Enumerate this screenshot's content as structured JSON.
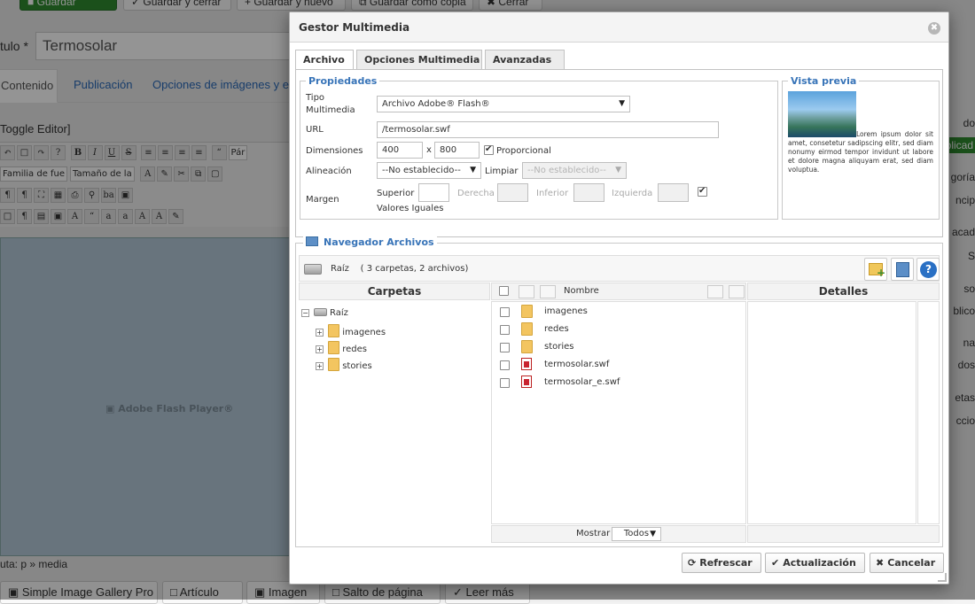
{
  "background": {
    "toolbar": [
      "Guardar",
      "Guardar y cerrar",
      "Guardar y nuevo",
      "Guardar como copia",
      "Cerrar"
    ],
    "title_label": "tulo *",
    "title_value": "Termosolar",
    "tabs": [
      "Contenido",
      "Publicación",
      "Opciones de imágenes y en"
    ],
    "toggle_editor": "Toggle Editor]",
    "editor_font_family": "Familia de fue",
    "editor_font_size": "Tamaño de la",
    "editor_paragraph": "Pár",
    "flash_label": "Adobe Flash Player®",
    "path": "uta: p » media",
    "bottom_buttons": [
      "Simple Image Gallery Pro",
      "Artículo",
      "Imagen",
      "Salto de página",
      "Leer más"
    ],
    "right_labels": [
      "do",
      "plicad",
      "goría",
      "ncip",
      "acad",
      "S",
      "so",
      "blico",
      "na",
      "dos",
      "etas",
      "ccio"
    ]
  },
  "modal": {
    "title": "Gestor Multimedia",
    "close_icon": "close-icon",
    "tabs": [
      "Archivo",
      "Opciones Multimedia",
      "Avanzadas"
    ],
    "properties": {
      "legend": "Propiedades",
      "tipo_label_1": "Tipo",
      "tipo_label_2": "Multimedia",
      "tipo_value": "Archivo Adobe® Flash®",
      "url_label": "URL",
      "url_value": "/termosolar.swf",
      "dimensions_label": "Dimensiones",
      "width": "400",
      "x": "x",
      "height": "800",
      "proportional_label": "Proporcional",
      "proportional_checked": true,
      "align_label": "Alineación",
      "align_value": "--No establecido--",
      "clear_label": "Limpiar",
      "clear_value": "--No establecido--",
      "margin_label": "Margen",
      "top_label": "Superior",
      "right_label": "Derecha",
      "bottom_label": "Inferior",
      "left_label": "Izquierda",
      "equal_values_label": "Valores Iguales",
      "equal_values_checked": true
    },
    "preview": {
      "legend": "Vista previa",
      "text": "Lorem ipsum dolor sit amet, consetetur sadipscing elitr, sed diam nonumy eirmod tempor invidunt ut labore et dolore magna aliquyam erat, sed diam voluptua."
    },
    "browser": {
      "legend": "Navegador Archivos",
      "root": "Raíz",
      "summary": "( 3 carpetas, 2 archivos)",
      "folders_header": "Carpetas",
      "name_header": "Nombre",
      "details_header": "Detalles",
      "tree": [
        "imagenes",
        "redes",
        "stories"
      ],
      "files": [
        {
          "name": "imagenes",
          "type": "folder"
        },
        {
          "name": "redes",
          "type": "folder"
        },
        {
          "name": "stories",
          "type": "folder"
        },
        {
          "name": "termosolar.swf",
          "type": "swf"
        },
        {
          "name": "termosolar_e.swf",
          "type": "swf"
        }
      ],
      "show_label": "Mostrar",
      "show_value": "Todos"
    },
    "buttons": {
      "refresh": "Refrescar",
      "update": "Actualización",
      "cancel": "Cancelar"
    }
  }
}
